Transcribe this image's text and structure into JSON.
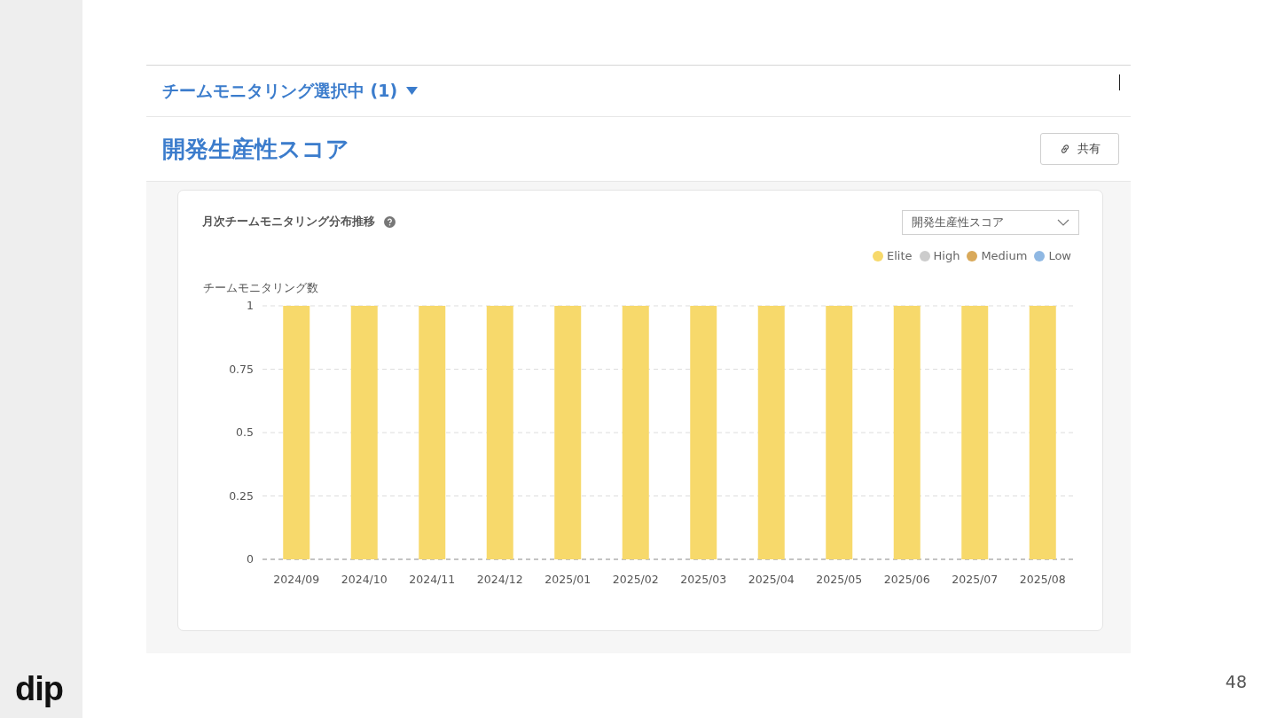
{
  "slide": {
    "logo": "dip",
    "page_number": "48"
  },
  "header": {
    "selector": "チームモニタリング選択中 (1)",
    "title": "開発生産性スコア",
    "share_button": "共有"
  },
  "card": {
    "title": "月次チームモニタリング分布推移",
    "dropdown": {
      "value": "開発生産性スコア"
    },
    "chart_data": {
      "type": "bar",
      "stacked": true,
      "grid": true,
      "ylabel": "チームモニタリング数",
      "categories": [
        "2024/09",
        "2024/10",
        "2024/11",
        "2024/12",
        "2025/01",
        "2025/02",
        "2025/03",
        "2025/04",
        "2025/05",
        "2025/06",
        "2025/07",
        "2025/08"
      ],
      "ylim": [
        0,
        1
      ],
      "yticks": [
        0,
        0.25,
        0.5,
        0.75,
        1
      ],
      "series": [
        {
          "name": "Elite",
          "color": "#f7d96b",
          "values": [
            1,
            1,
            1,
            1,
            1,
            1,
            1,
            1,
            1,
            1,
            1,
            1
          ]
        },
        {
          "name": "High",
          "color": "#cccccc",
          "values": [
            0,
            0,
            0,
            0,
            0,
            0,
            0,
            0,
            0,
            0,
            0,
            0
          ]
        },
        {
          "name": "Medium",
          "color": "#d9a95a",
          "values": [
            0,
            0,
            0,
            0,
            0,
            0,
            0,
            0,
            0,
            0,
            0,
            0
          ]
        },
        {
          "name": "Low",
          "color": "#8fb8e3",
          "values": [
            0,
            0,
            0,
            0,
            0,
            0,
            0,
            0,
            0,
            0,
            0,
            0
          ]
        }
      ]
    }
  }
}
